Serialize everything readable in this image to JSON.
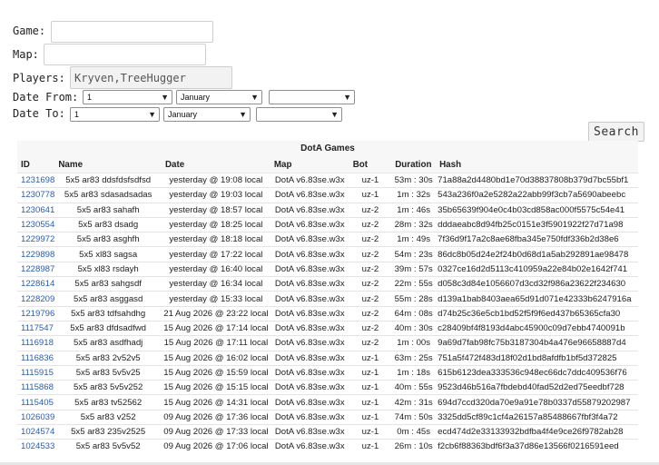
{
  "form": {
    "game_label": "Game:",
    "game_value": "",
    "map_label": "Map:",
    "map_value": "",
    "players_label": "Players:",
    "players_value": "Kryven,TreeHugger",
    "date_from_label": "Date From:",
    "date_to_label": "Date To:",
    "from_day": "1",
    "from_month": "January",
    "from_year": "",
    "to_day": "1",
    "to_month": "January",
    "to_year": "",
    "search_label": "Search"
  },
  "table": {
    "caption": "DotA Games",
    "headers": [
      "ID",
      "Name",
      "Date",
      "Map",
      "Bot",
      "Duration",
      "Hash"
    ],
    "rows": [
      [
        "1231698",
        "5x5 ar83 ddsfdsfsdfsd",
        "yesterday @ 19:08 local",
        "DotA v6.83se.w3x",
        "uz-1",
        "53m : 30s",
        "71a88a2d4480bd1e70d38837808b379d7bc55bf1"
      ],
      [
        "1230778",
        "5x5 ar83 sdasadsadas",
        "yesterday @ 19:03 local",
        "DotA v6.83se.w3x",
        "uz-1",
        "1m : 32s",
        "543a236f0a2e5282a22abb99f3cb7a5690abeebc"
      ],
      [
        "1230641",
        "5x5 ar83 sahafh",
        "yesterday @ 18:57 local",
        "DotA v6.83se.w3x",
        "uz-2",
        "1m : 46s",
        "35b65639f904e0c4b03cd858ac000f5575c54e41"
      ],
      [
        "1230554",
        "5x5 ar83 dsadg",
        "yesterday @ 18:25 local",
        "DotA v6.83se.w3x",
        "uz-2",
        "28m : 32s",
        "dddaeabc8d94fb25c0151e3f5901922f27d71a98"
      ],
      [
        "1229972",
        "5x5 ar83 asghfh",
        "yesterday @ 18:18 local",
        "DotA v6.83se.w3x",
        "uz-2",
        "1m : 49s",
        "7f36d9f17a2c8ae68fba345e750fdf336b2d38e6"
      ],
      [
        "1229898",
        "5x5 xl83 sagsa",
        "yesterday @ 17:22 local",
        "DotA v6.83se.w3x",
        "uz-2",
        "54m : 23s",
        "86dc8b05d24e2f24b0d68d1a5ab292891ae98478"
      ],
      [
        "1228987",
        "5x5 xl83 rsdayh",
        "yesterday @ 16:40 local",
        "DotA v6.83se.w3x",
        "uz-2",
        "39m : 57s",
        "0327ce16d2d5113c410959a22e84b02e1642f741"
      ],
      [
        "1228614",
        "5x5 ar83 sahgsdf",
        "yesterday @ 16:34 local",
        "DotA v6.83se.w3x",
        "uz-2",
        "22m : 55s",
        "d058c3d84e1056607d3cd32f986a23622f234630"
      ],
      [
        "1228209",
        "5x5 ar83 asggasd",
        "yesterday @ 15:33 local",
        "DotA v6.83se.w3x",
        "uz-2",
        "55m : 28s",
        "d139a1bab8403aea65d91d071e42333b6247916a"
      ],
      [
        "1219796",
        "5x5 ar83 tdfsahdhg",
        "21 Aug 2026 @ 23:22 local",
        "DotA v6.83se.w3x",
        "uz-2",
        "64m : 08s",
        "d74b25c36e5cb1bd52f5f9f6ed437b65365cfa30"
      ],
      [
        "1117547",
        "5x5 ar83 dfdsadfwd",
        "15 Aug 2026 @ 17:14 local",
        "DotA v6.83se.w3x",
        "uz-2",
        "40m : 30s",
        "c28409bf4f8193d4abc45900c09d7ebb4740091b"
      ],
      [
        "1116918",
        "5x5 ar83 asdfhadj",
        "15 Aug 2026 @ 17:11 local",
        "DotA v6.83se.w3x",
        "uz-2",
        "1m : 00s",
        "9a69d7fab98fc75b3187304b4a476e96658887d4"
      ],
      [
        "1116836",
        "5x5 ar83 2v52v5",
        "15 Aug 2026 @ 16:02 local",
        "DotA v6.83se.w3x",
        "uz-1",
        "63m : 25s",
        "751a5f472f483d18f02d1bd8afdfb1bf5d372825"
      ],
      [
        "1115915",
        "5x5 ar83 5v5v25",
        "15 Aug 2026 @ 15:59 local",
        "DotA v6.83se.w3x",
        "uz-1",
        "1m : 18s",
        "615b6123dea333536c948ec66dc7ddc409536f76"
      ],
      [
        "1115868",
        "5x5 ar83 5v5v252",
        "15 Aug 2026 @ 15:15 local",
        "DotA v6.83se.w3x",
        "uz-1",
        "40m : 55s",
        "9523d46b516a7fbdebd40fad52d2ed75eedbf728"
      ],
      [
        "1115405",
        "5x5 ar83 tv52562",
        "15 Aug 2026 @ 14:31 local",
        "DotA v6.83se.w3x",
        "uz-1",
        "42m : 31s",
        "694d7ccd320da70e9a91e78b0337d55879202987"
      ],
      [
        "1026039",
        "5x5 ar83 v252",
        "09 Aug 2026 @ 17:36 local",
        "DotA v6.83se.w3x",
        "uz-1",
        "74m : 50s",
        "3325dd5cf89c1cf4a26157a85488667fbf3f4a72"
      ],
      [
        "1024574",
        "5x5 ar83 235v2525",
        "09 Aug 2026 @ 17:33 local",
        "DotA v6.83se.w3x",
        "uz-1",
        "0m : 45s",
        "ecd474d2e33133932bdfba4f4e9ce26f9782ab28"
      ],
      [
        "1024533",
        "5x5 ar83 5v5v52",
        "09 Aug 2026 @ 17:06 local",
        "DotA v6.83se.w3x",
        "uz-1",
        "26m : 10s",
        "f2cb6f88363bdf6f3a37d86e13566f0216591eed"
      ]
    ]
  }
}
